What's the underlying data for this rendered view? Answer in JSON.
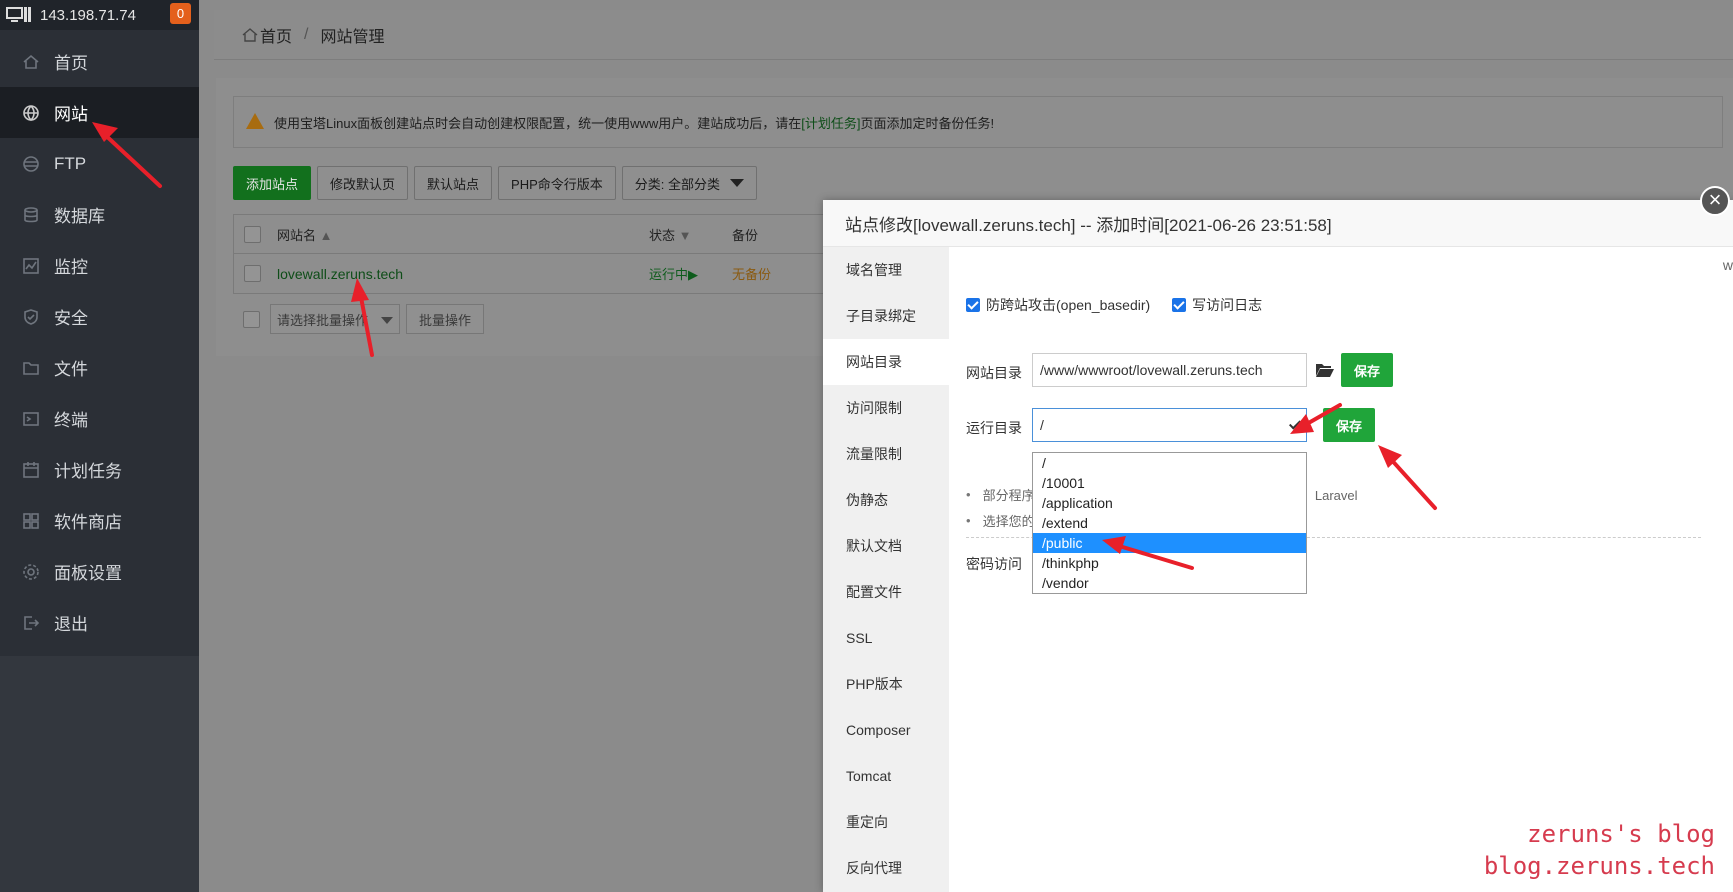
{
  "sidebar": {
    "ip": "143.198.71.74",
    "badge": "0",
    "items": [
      {
        "label": "首页",
        "icon": "home-icon"
      },
      {
        "label": "网站",
        "icon": "globe-icon"
      },
      {
        "label": "FTP",
        "icon": "ftp-icon"
      },
      {
        "label": "数据库",
        "icon": "database-icon"
      },
      {
        "label": "监控",
        "icon": "monitor-icon"
      },
      {
        "label": "安全",
        "icon": "shield-icon"
      },
      {
        "label": "文件",
        "icon": "folder-icon"
      },
      {
        "label": "终端",
        "icon": "terminal-icon"
      },
      {
        "label": "计划任务",
        "icon": "calendar-icon"
      },
      {
        "label": "软件商店",
        "icon": "grid-icon"
      },
      {
        "label": "面板设置",
        "icon": "gear-icon"
      },
      {
        "label": "退出",
        "icon": "logout-icon"
      }
    ],
    "active_index": 1
  },
  "breadcrumb": {
    "home": "首页",
    "sep": "/",
    "current": "网站管理"
  },
  "notice": {
    "text_before": "使用宝塔Linux面板创建站点时会自动创建权限配置，统一使用www用户。建站成功后，请在",
    "link": "[计划任务]",
    "text_after": "页面添加定时备份任务!"
  },
  "toolbar": {
    "add": "添加站点",
    "edit_default": "修改默认页",
    "default_site": "默认站点",
    "php_cli": "PHP命令行版本",
    "category": "分类: 全部分类"
  },
  "table": {
    "headers": {
      "name": "网站名",
      "status": "状态",
      "backup": "备份"
    },
    "rows": [
      {
        "name": "lovewall.zeruns.tech",
        "status": "运行中▶",
        "backup": "无备份"
      }
    ]
  },
  "bulk": {
    "select_placeholder": "请选择批量操作",
    "button": "批量操作"
  },
  "modal": {
    "title": "站点修改[lovewall.zeruns.tech] -- 添加时间[2021-06-26 23:51:58]",
    "tabs": [
      "域名管理",
      "子目录绑定",
      "网站目录",
      "访问限制",
      "流量限制",
      "伪静态",
      "默认文档",
      "配置文件",
      "SSL",
      "PHP版本",
      "Composer",
      "Tomcat",
      "重定向",
      "反向代理"
    ],
    "active_tab": 2,
    "checkbox1": "防跨站攻击(open_basedir)",
    "checkbox2": "写访问日志",
    "site_dir_label": "网站目录",
    "site_dir_value": "/www/wwwroot/lovewall.zeruns.tech",
    "save_label": "保存",
    "run_dir_label": "运行目录",
    "run_dir_value": "/",
    "run_dir_options": [
      "/",
      "/10001",
      "/application",
      "/extend",
      "/public",
      "/thinkphp",
      "/vendor"
    ],
    "selected_option": 4,
    "tip1_start": "部分程序",
    "tip1_end": "HP5，Laravel",
    "tip2_start": "选择您的",
    "password_label": "密码访问",
    "right_edge_text": "w"
  },
  "watermark": {
    "line1": "zeruns's blog",
    "line2": "blog.zeruns.tech"
  },
  "colors": {
    "accent_green": "#20a53a",
    "arrow_red": "#e8202a",
    "select_blue": "#1e90ff"
  }
}
